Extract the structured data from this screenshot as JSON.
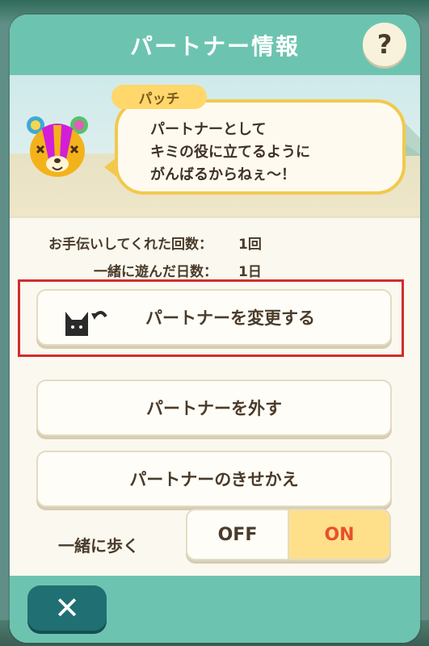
{
  "title": "パートナー情報",
  "help_label": "?",
  "partner": {
    "name": "パッチ",
    "speech_lines": [
      "パートナーとして",
      "キミの役に立てるように",
      "がんばるからねぇ～！"
    ]
  },
  "stats": {
    "help_count_label": "お手伝いしてくれた回数：",
    "help_count_value": "1回",
    "days_label": "一緒に遊んだ日数：",
    "days_value": "1日"
  },
  "buttons": {
    "change_partner": "パートナーを変更する",
    "remove_partner": "パートナーを外す",
    "dress_up": "パートナーのきせかえ"
  },
  "walk_together": {
    "label": "一緒に歩く",
    "off_label": "OFF",
    "on_label": "ON",
    "selected": "ON"
  },
  "close_label": "✕",
  "colors": {
    "header": "#6cc4b0",
    "highlight_border": "#cf2e2e",
    "toggle_on_bg": "#ffe08a",
    "toggle_on_text": "#e8502e"
  },
  "icons": {
    "help": "question-mark-icon",
    "change": "cat-swap-icon",
    "close": "close-icon"
  }
}
